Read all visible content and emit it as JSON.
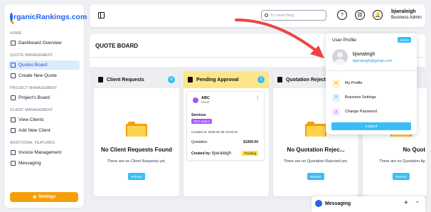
{
  "brand": {
    "logo_rest": "rganicRankings.com"
  },
  "sidebar": {
    "sections": [
      {
        "label": "HOME",
        "items": [
          {
            "label": "Dashboard Overview"
          }
        ]
      },
      {
        "label": "QUOTE MANAGEMENT",
        "items": [
          {
            "label": "Quotes Board"
          },
          {
            "label": "Create New Quote"
          }
        ]
      },
      {
        "label": "PROJECT MANAGEMENT",
        "items": [
          {
            "label": "Project's Board"
          }
        ]
      },
      {
        "label": "CLIENT MANAGEMENT",
        "items": [
          {
            "label": "View Clients"
          },
          {
            "label": "Add New Client"
          }
        ]
      },
      {
        "label": "ADDITIONAL FEATURES",
        "items": [
          {
            "label": "Invoice Management"
          },
          {
            "label": "Messaging"
          }
        ]
      }
    ],
    "settings_label": "Settings"
  },
  "header": {
    "search_placeholder": "Try searching",
    "user_name": "bjwraleigh",
    "user_role": "Business Admin"
  },
  "main": {
    "title": "QUOTE BOARD",
    "columns": [
      {
        "title": "Client Requests",
        "count": "0",
        "empty_title": "No Client Requests Found",
        "empty_sub": "There are no Client Requests yet.",
        "refresh": "Refresh"
      },
      {
        "title": "Pending Approval",
        "count": "1"
      },
      {
        "title": "Quotation Rejected",
        "empty_title": "No Quotation Rejec...",
        "empty_sub": "There are no Quotation Rejected yet.",
        "refresh": "Refresh"
      },
      {
        "empty_title": "No Quot",
        "empty_sub": "There are no Quotation Ap",
        "refresh": "Refresh"
      }
    ],
    "quote_card": {
      "client_name": "ABC",
      "client_label": "Client",
      "services_label": "Services",
      "service_tag": "SEO pages",
      "created": "Created at: 2025-01-08 15:53:22",
      "quotation_label": "Quotation:",
      "quotation_value": "$1000.00",
      "created_by_label": "Created by:",
      "created_by_user": "bjwraleigh",
      "status": "Pending"
    }
  },
  "profile_menu": {
    "title": "User Profile",
    "badge": "Admin",
    "name": "bjwraleigh",
    "email": "bjwraleigh@gmail.com",
    "items": [
      {
        "label": "My Profile"
      },
      {
        "label": "Business Settings"
      },
      {
        "label": "Change Password"
      }
    ],
    "logout": "Logout"
  },
  "messaging": {
    "label": "Messaging"
  },
  "colors": {
    "accent": "#38bdf8",
    "brand": "#2563eb",
    "orange": "#f59e0b",
    "arrow": "#ef4444",
    "pending_head": "#fde68a",
    "purple": "#a855f7"
  }
}
